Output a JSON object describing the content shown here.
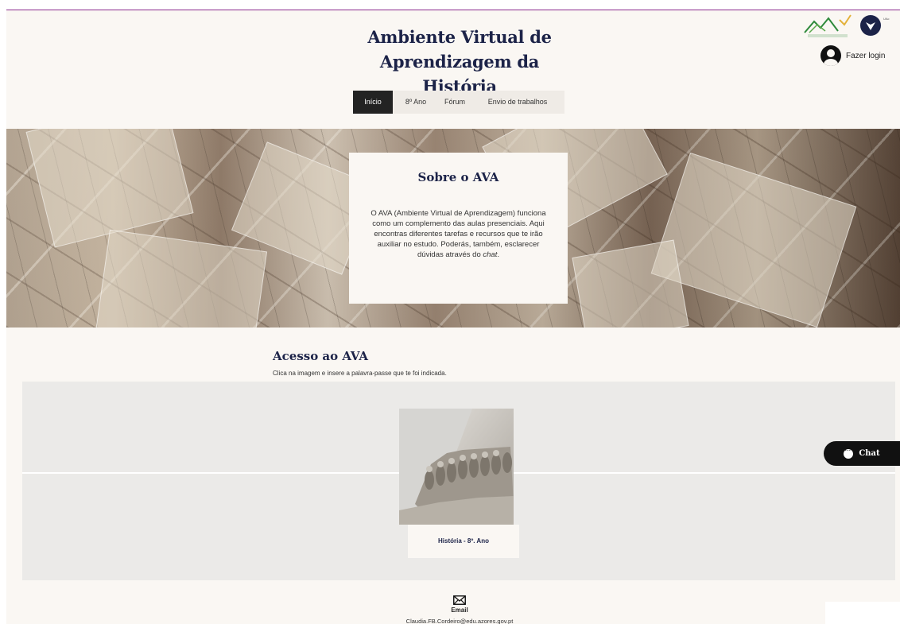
{
  "header": {
    "site_title": "Ambiente Virtual de Aprendizagem da História",
    "login_label": "Fazer login",
    "logos": {
      "ebs_text": "EBS do NORDESTE",
      "uac_text": "UAc"
    }
  },
  "nav": {
    "items": [
      {
        "label": "Início",
        "active": true
      },
      {
        "label": "8º Ano",
        "active": false
      },
      {
        "label": "Fórum",
        "active": false
      },
      {
        "label": "Envio de trabalhos",
        "active": false
      }
    ]
  },
  "about": {
    "title": "Sobre o AVA",
    "text_main": "O AVA (Ambiente Virtual de Aprendizagem) funciona como um complemento das aulas presenciais. Aqui encontras diferentes tarefas e recursos que te irão auxiliar no estudo. Poderás, também, esclarecer dúvidas através do ",
    "text_em": "chat",
    "text_end": "."
  },
  "access": {
    "title": "Acesso ao AVA",
    "subtitle": "Clica na imagem e insere a palavra-passe que te foi indicada.",
    "card_caption": "História - 8º. Ano"
  },
  "chat": {
    "label": "Chat"
  },
  "footer": {
    "email_label": "Email",
    "email_address": "Claudia.FB.Cordeiro@edu.azores.gov.pt"
  },
  "colors": {
    "title_navy": "#1c2348",
    "accent_purple": "#8b2c8e",
    "nav_active": "#232323",
    "page_bg": "#faf7f3"
  }
}
